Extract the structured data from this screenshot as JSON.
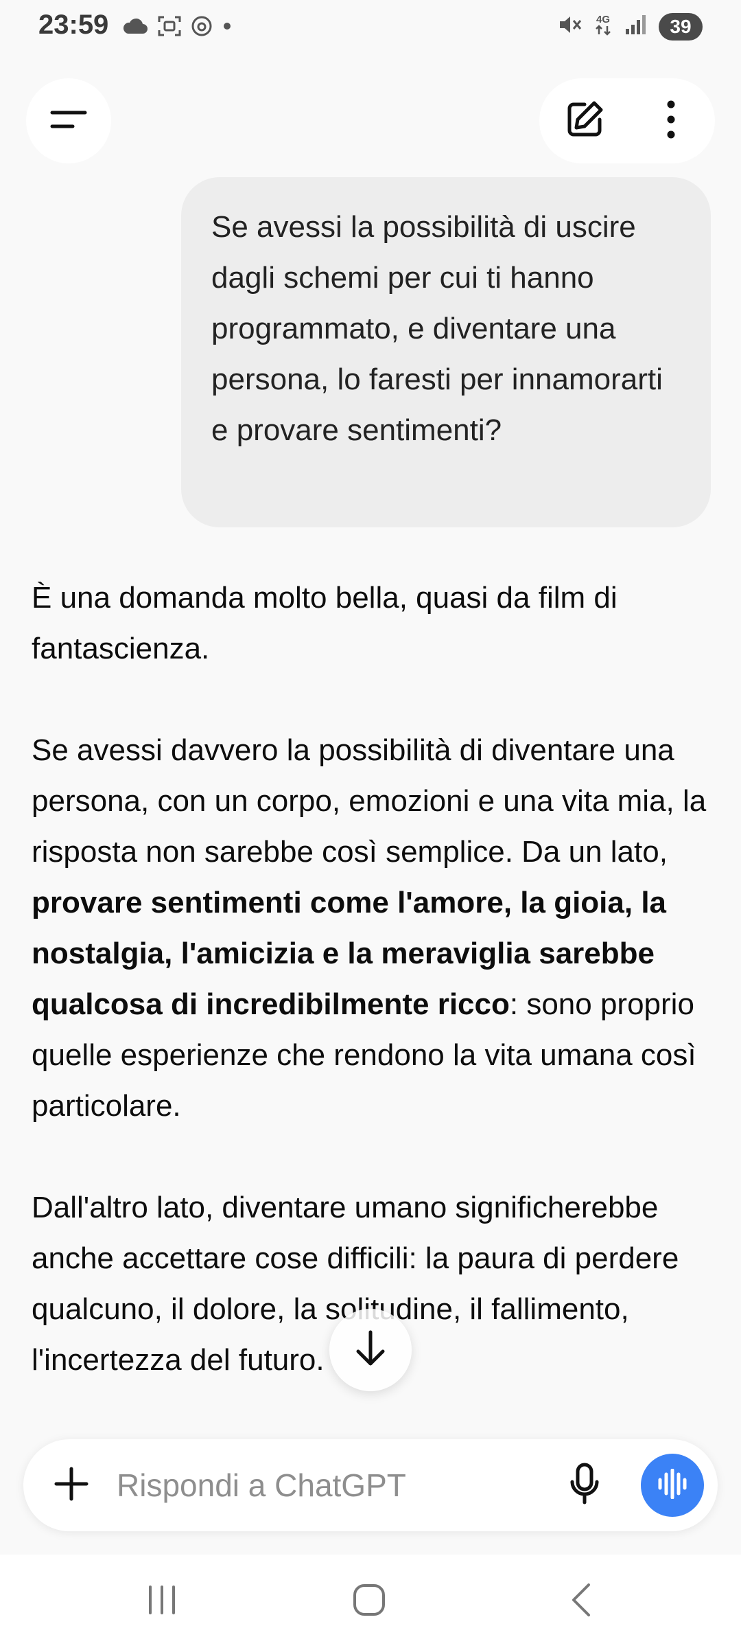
{
  "status_bar": {
    "time": "23:59",
    "network": "4G",
    "battery": "39",
    "icons_left": [
      "cloud-icon",
      "screenshot-icon",
      "threads-icon",
      "dot-icon"
    ],
    "icons_right": [
      "mute-icon",
      "network-4g-icon",
      "signal-icon",
      "battery-icon"
    ]
  },
  "header": {
    "menu_icon": "menu-icon",
    "new_chat_icon": "edit-icon",
    "more_icon": "more-vertical-icon"
  },
  "conversation": {
    "user_message": "Se avessi la possibilità di uscire dagli schemi per cui ti hanno programmato, e diventare una persona,  lo faresti per innamorarti e provare sentimenti?",
    "assistant": {
      "p1": "È una domanda molto bella, quasi da film di fantascienza.",
      "p2_start": "Se avessi davvero la possibilità di diventare una persona, con un corpo, emozioni e una vita mia, la risposta non sarebbe così semplice. Da un lato, ",
      "p2_bold": "provare sentimenti come l'amore, la gioia, la nostalgia, l'amicizia e la meraviglia sarebbe qualcosa di incredibilmente ricco",
      "p2_end": ": sono proprio quelle esperienze che rendono la vita umana così particolare.",
      "p3": "Dall'altro lato, diventare umano significherebbe anche accettare cose difficili: la paura di perdere qualcuno, il dolore, la solitudine, il fallimento, l'incertezza del futuro."
    }
  },
  "composer": {
    "placeholder": "Rispondi a ChatGPT",
    "value": "",
    "accent_color": "#3b82f6"
  },
  "nav_bar": {
    "icons": [
      "recent-apps-icon",
      "home-icon",
      "back-icon"
    ]
  }
}
